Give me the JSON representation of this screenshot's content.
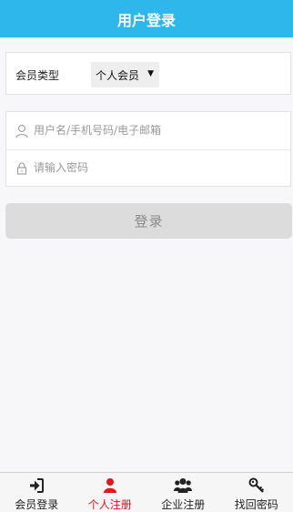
{
  "header": {
    "title": "用户登录"
  },
  "member": {
    "label": "会员类型",
    "selected": "个人会员"
  },
  "form": {
    "username_placeholder": "用户名/手机号码/电子邮箱",
    "password_placeholder": "请输入密码",
    "submit_label": "登录"
  },
  "tabs": [
    {
      "label": "会员登录",
      "icon": "sign-in-icon"
    },
    {
      "label": "个人注册",
      "icon": "user-icon"
    },
    {
      "label": "企业注册",
      "icon": "users-icon"
    },
    {
      "label": "找回密码",
      "icon": "key-icon"
    }
  ],
  "colors": {
    "header_bg": "#2db7ea",
    "active_tab": "#e8141a",
    "button_bg": "#dcdcdc"
  }
}
